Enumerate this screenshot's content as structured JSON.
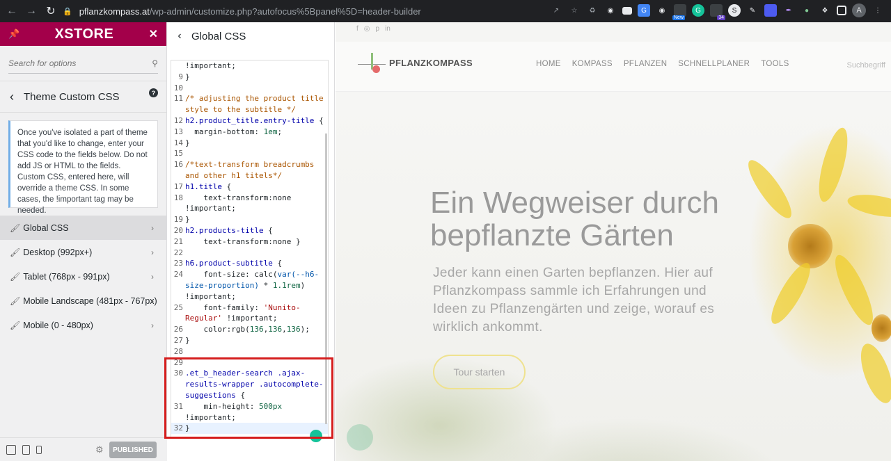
{
  "browser": {
    "url_host": "pflanzkompass.at",
    "url_path": "/wp-admin/customize.php?autofocus%5Bpanel%5D=header-builder",
    "ext_new_label": "New",
    "ext_count": "34",
    "avatar_letter": "A"
  },
  "sidebar": {
    "brand": "XSTORE",
    "search_placeholder": "Search for options",
    "section_title": "Theme Custom CSS",
    "description": "Once you've isolated a part of theme that you'd like to change, enter your CSS code to the fields below. Do not add JS or HTML to the fields. Custom CSS, entered here, will override a theme CSS. In some cases, the !important tag may be needed.",
    "items": [
      {
        "label": "Global CSS"
      },
      {
        "label": "Desktop (992px+)"
      },
      {
        "label": "Tablet (768px - 991px)"
      },
      {
        "label": "Mobile Landscape (481px - 767px)"
      },
      {
        "label": "Mobile (0 - 480px)"
      }
    ],
    "publish_label": "PUBLISHED"
  },
  "css_panel": {
    "title": "Global CSS",
    "lines": [
      {
        "n": "",
        "t": "!important;"
      },
      {
        "n": "9",
        "t": "}"
      },
      {
        "n": "10",
        "t": ""
      },
      {
        "n": "11",
        "t": "/* adjusting the product title style to the subtitle */"
      },
      {
        "n": "12",
        "t": "h2.product_title.entry-title {"
      },
      {
        "n": "13",
        "t": "  margin-bottom: 1em;"
      },
      {
        "n": "14",
        "t": "}"
      },
      {
        "n": "15",
        "t": ""
      },
      {
        "n": "16",
        "t": "/*text-transform breadcrumbs and other h1 titels*/"
      },
      {
        "n": "17",
        "t": "h1.title {"
      },
      {
        "n": "18",
        "t": "    text-transform:none !important;"
      },
      {
        "n": "19",
        "t": "}"
      },
      {
        "n": "20",
        "t": "h2.products-title {"
      },
      {
        "n": "21",
        "t": "    text-transform:none }"
      },
      {
        "n": "22",
        "t": ""
      },
      {
        "n": "23",
        "t": "h6.product-subtitle {"
      },
      {
        "n": "24",
        "t": "    font-size: calc(var(--h6-size-proportion) * 1.1rem) !important;"
      },
      {
        "n": "25",
        "t": "    font-family: 'Nunito-Regular' !important;"
      },
      {
        "n": "26",
        "t": "    color:rgb(136,136,136);"
      },
      {
        "n": "27",
        "t": "}"
      },
      {
        "n": "28",
        "t": ""
      },
      {
        "n": "29",
        "t": ""
      },
      {
        "n": "30",
        "t": ".et_b_header-search .ajax-results-wrapper .autocomplete-suggestions {"
      },
      {
        "n": "31",
        "t": "    min-height: 500px !important;"
      },
      {
        "n": "32",
        "t": "}"
      }
    ]
  },
  "preview": {
    "logo_text": "PFLANZKOMPASS",
    "menu": [
      "HOME",
      "KOMPASS",
      "PFLANZEN",
      "SCHNELLPLANER",
      "TOOLS"
    ],
    "search_hint": "Suchbegriff",
    "hero_title": "Ein Wegweiser durch bepflanzte Gärten",
    "hero_sub": "Jeder kann einen Garten bepflanzen. Hier auf Pflanzkompass sammle ich Erfahrungen und Ideen zu Pflanzengärten und zeige, worauf es wirklich ankommt.",
    "cta": "Tour starten"
  },
  "colors": {
    "brand": "#a3004a",
    "highlight": "#d51e1e",
    "cta_border": "#efe28f"
  }
}
